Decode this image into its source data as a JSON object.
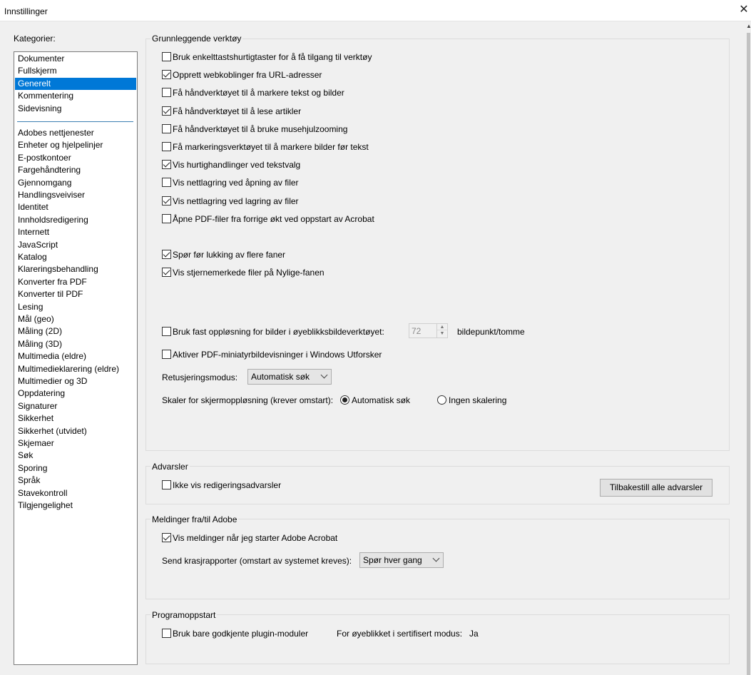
{
  "window": {
    "title": "Innstillinger"
  },
  "categories": {
    "label": "Kategorier:",
    "top_items": [
      "Dokumenter",
      "Fullskjerm",
      "Generelt",
      "Kommentering",
      "Sidevisning"
    ],
    "selected": "Generelt",
    "items": [
      "Adobes nettjenester",
      "Enheter og hjelpelinjer",
      "E-postkontoer",
      "Fargehåndtering",
      "Gjennomgang",
      "Handlingsveiviser",
      "Identitet",
      "Innholdsredigering",
      "Internett",
      "JavaScript",
      "Katalog",
      "Klareringsbehandling",
      "Konverter fra PDF",
      "Konverter til PDF",
      "Lesing",
      "Mål (geo)",
      "Måling (2D)",
      "Måling (3D)",
      "Multimedia (eldre)",
      "Multimedieklarering (eldre)",
      "Multimedier og 3D",
      "Oppdatering",
      "Signaturer",
      "Sikkerhet",
      "Sikkerhet (utvidet)",
      "Skjemaer",
      "Søk",
      "Sporing",
      "Språk",
      "Stavekontroll",
      "Tilgjengelighet"
    ]
  },
  "basic_tools": {
    "title": "Grunnleggende verktøy",
    "checkboxes": [
      {
        "label": "Bruk enkelttastshurtigtaster for å få tilgang til verktøy",
        "checked": false
      },
      {
        "label": "Opprett webkoblinger fra URL-adresser",
        "checked": true
      },
      {
        "label": "Få håndverktøyet til å markere tekst og bilder",
        "checked": false
      },
      {
        "label": "Få håndverktøyet til å lese artikler",
        "checked": true
      },
      {
        "label": "Få håndverktøyet til å bruke musehjulzooming",
        "checked": false
      },
      {
        "label": "Få markeringsverktøyet til å markere bilder før tekst",
        "checked": false
      },
      {
        "label": "Vis hurtighandlinger ved tekstvalg",
        "checked": true
      },
      {
        "label": "Vis nettlagring ved åpning av filer",
        "checked": false
      },
      {
        "label": "Vis nettlagring ved lagring av filer",
        "checked": true
      },
      {
        "label": "Åpne PDF-filer fra forrige økt ved oppstart av Acrobat",
        "checked": false
      }
    ],
    "checkboxes2": [
      {
        "label": "Spør før lukking av flere faner",
        "checked": true
      },
      {
        "label": "Vis stjernemerkede filer på Nylige-fanen",
        "checked": true
      }
    ],
    "fixed_resolution": {
      "label": "Bruk fast oppløsning for bilder i øyeblikksbildeverktøyet:",
      "checked": false,
      "value": "72",
      "unit": "bildepunkt/tomme"
    },
    "thumbnails": {
      "label": "Aktiver PDF-miniatyrbildevisninger i Windows Utforsker",
      "checked": false
    },
    "retouch": {
      "label": "Retusjeringsmodus:",
      "value": "Automatisk søk"
    },
    "scale": {
      "label": "Skaler for skjermoppløsning (krever omstart):",
      "options": [
        "Automatisk søk",
        "Ingen skalering"
      ],
      "selected": "Automatisk søk"
    }
  },
  "warnings": {
    "title": "Advarsler",
    "checkbox": {
      "label": "Ikke vis redigeringsadvarsler",
      "checked": false
    },
    "reset_button": "Tilbakestill alle advarsler"
  },
  "messages": {
    "title": "Meldinger fra/til Adobe",
    "checkbox": {
      "label": "Vis meldinger når jeg starter Adobe Acrobat",
      "checked": true
    },
    "crash_label": "Send krasjrapporter (omstart av systemet kreves):",
    "crash_value": "Spør hver gang"
  },
  "startup": {
    "title": "Programoppstart",
    "checkbox": {
      "label": "Bruk bare godkjente plugin-moduler",
      "checked": false
    },
    "certified_label": "For øyeblikket i sertifisert modus:",
    "certified_value": "Ja"
  },
  "colors": {
    "selection": "#0078d7",
    "separator": "#3c7fb1"
  }
}
